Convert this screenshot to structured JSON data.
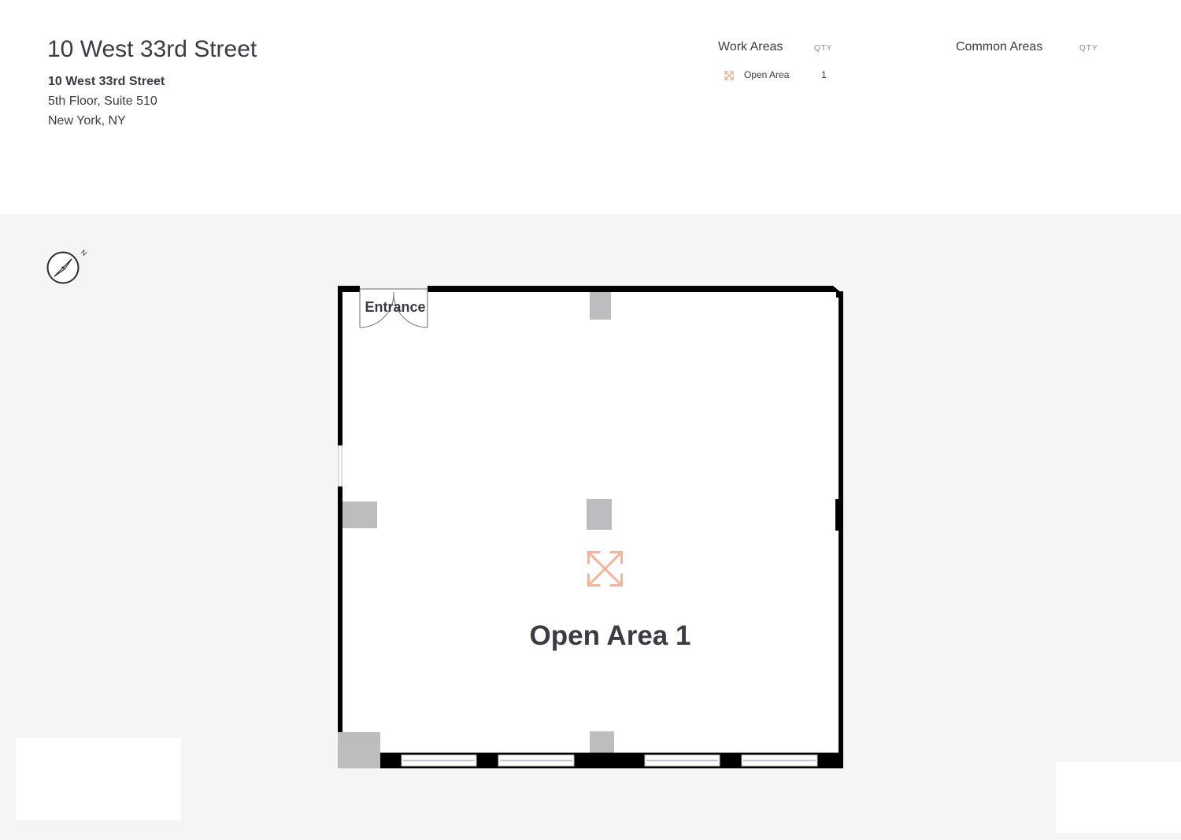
{
  "header": {
    "title": "10 West 33rd Street",
    "address": {
      "name": "10 West 33rd Street",
      "line1": "5th Floor, Suite 510",
      "line2": "New York, NY"
    }
  },
  "legend": {
    "work_areas": {
      "heading": "Work Areas",
      "qty_label": "QTY",
      "items": [
        {
          "label": "Open Area",
          "qty": "1",
          "icon": "expand-arrows-icon",
          "color": "#f4b49b"
        }
      ]
    },
    "common_areas": {
      "heading": "Common Areas",
      "qty_label": "QTY",
      "items": []
    }
  },
  "compass": {
    "label": "N",
    "icon": "compass-icon"
  },
  "floorplan": {
    "entrance_label": "Entrance",
    "room_label": "Open Area 1",
    "room_icon": "expand-arrows-icon",
    "colors": {
      "wall": "#000000",
      "column": "#bdbdbf",
      "room_fill": "#ffffff",
      "accent": "#f4b49b",
      "label": "#3b3b45"
    }
  }
}
